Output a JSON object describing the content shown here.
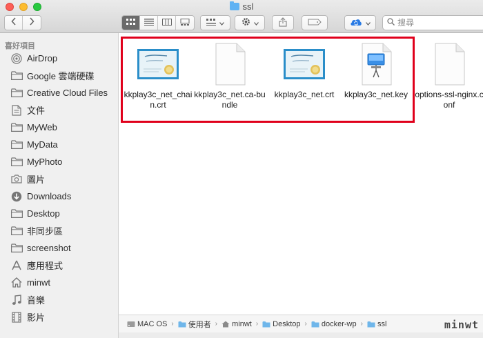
{
  "window": {
    "title": "ssl"
  },
  "toolbar": {
    "search_placeholder": "搜尋"
  },
  "sidebar": {
    "section_title": "喜好項目",
    "items": [
      {
        "label": "AirDrop",
        "icon": "airdrop-icon"
      },
      {
        "label": "Google 雲端硬碟",
        "icon": "folder-icon"
      },
      {
        "label": "Creative Cloud Files",
        "icon": "folder-icon"
      },
      {
        "label": "文件",
        "icon": "document-icon"
      },
      {
        "label": "MyWeb",
        "icon": "folder-icon"
      },
      {
        "label": "MyData",
        "icon": "folder-icon"
      },
      {
        "label": "MyPhoto",
        "icon": "folder-icon"
      },
      {
        "label": "圖片",
        "icon": "camera-icon"
      },
      {
        "label": "Downloads",
        "icon": "download-icon"
      },
      {
        "label": "Desktop",
        "icon": "folder-icon"
      },
      {
        "label": "非同步區",
        "icon": "folder-icon"
      },
      {
        "label": "screenshot",
        "icon": "folder-icon"
      },
      {
        "label": "應用程式",
        "icon": "apps-icon"
      },
      {
        "label": "minwt",
        "icon": "home-icon"
      },
      {
        "label": "音樂",
        "icon": "music-icon"
      },
      {
        "label": "影片",
        "icon": "film-icon"
      }
    ]
  },
  "files": [
    {
      "name": "kkplay3c_net_chain.crt",
      "icon": "certificate-icon"
    },
    {
      "name": "kkplay3c_net.ca-bundle",
      "icon": "blank-file-icon"
    },
    {
      "name": "kkplay3c_net.crt",
      "icon": "certificate-icon"
    },
    {
      "name": "kkplay3c_net.key",
      "icon": "keynote-icon"
    },
    {
      "name": "options-ssl-nginx.conf",
      "icon": "blank-file-icon"
    }
  ],
  "pathbar": {
    "crumbs": [
      "MAC OS",
      "使用者",
      "minwt",
      "Desktop",
      "docker-wp",
      "ssl"
    ]
  },
  "watermark": "minwt"
}
